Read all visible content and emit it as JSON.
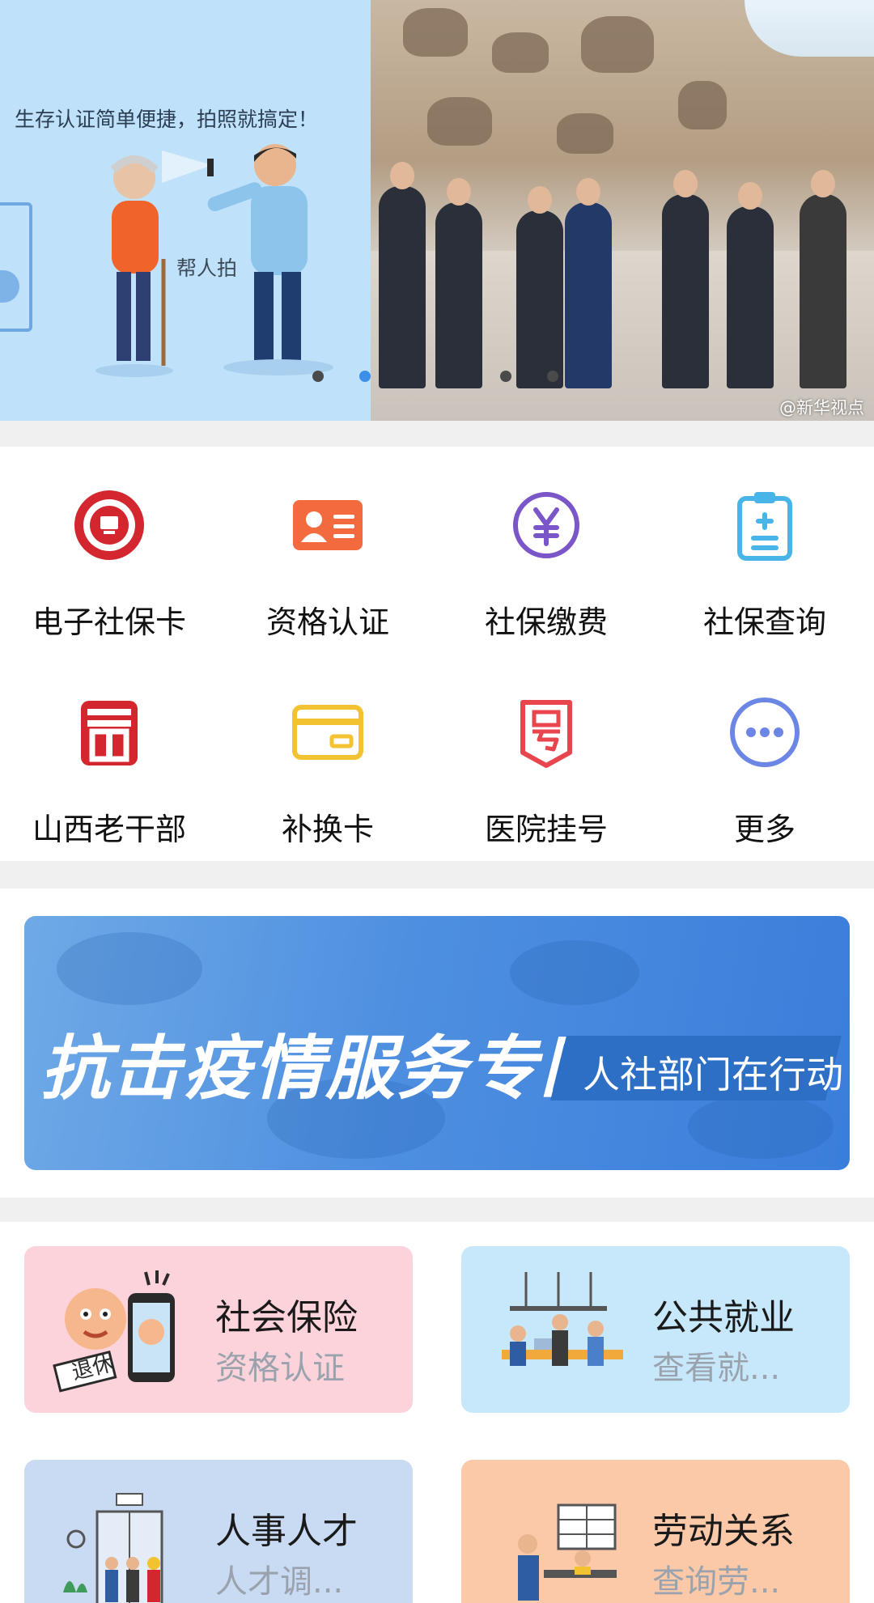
{
  "carousel": {
    "slide_left": {
      "tagline": "生存认证简单便捷，拍照就搞定！",
      "help_label": "帮人拍"
    },
    "slide_right": {
      "watermark": "@新华视点"
    },
    "dot_count_left": 2,
    "dot_count_right": 2,
    "active_dot_index": 1
  },
  "grid": {
    "items": [
      {
        "label": "电子社保卡",
        "icon": "social-security-card-icon",
        "color": "#d3262e"
      },
      {
        "label": "资格认证",
        "icon": "id-card-icon",
        "color": "#f26a3d"
      },
      {
        "label": "社保缴费",
        "icon": "yuan-icon",
        "color": "#7a56c8"
      },
      {
        "label": "社保查询",
        "icon": "clipboard-icon",
        "color": "#49b4e8"
      },
      {
        "label": "山西老干部",
        "icon": "shanxi-logo-icon",
        "color": "#d3262e"
      },
      {
        "label": "补换卡",
        "icon": "card-icon",
        "color": "#f2c230"
      },
      {
        "label": "医院挂号",
        "icon": "registration-icon",
        "color": "#e8454e"
      },
      {
        "label": "更多",
        "icon": "more-icon",
        "color": "#6c86e6"
      }
    ]
  },
  "banner": {
    "title": "抗击疫情服务专区",
    "subtitle": "人社部门在行动",
    "color": "#4a8ae0"
  },
  "cards": [
    {
      "title": "社会保险",
      "subtitle": "资格认证",
      "badge": "退休",
      "bg": "#fcd3da",
      "illus": "retiree-phone-illustration"
    },
    {
      "title": "公共就业",
      "subtitle": "查看就...",
      "bg": "#c7e8fa",
      "illus": "office-workers-illustration"
    },
    {
      "title": "人事人才",
      "subtitle": "人才调...",
      "bg": "#c9daf3",
      "illus": "elevator-people-illustration"
    },
    {
      "title": "劳动关系",
      "subtitle": "查询劳...",
      "bg": "#fbc8a8",
      "illus": "desk-meeting-illustration"
    }
  ]
}
